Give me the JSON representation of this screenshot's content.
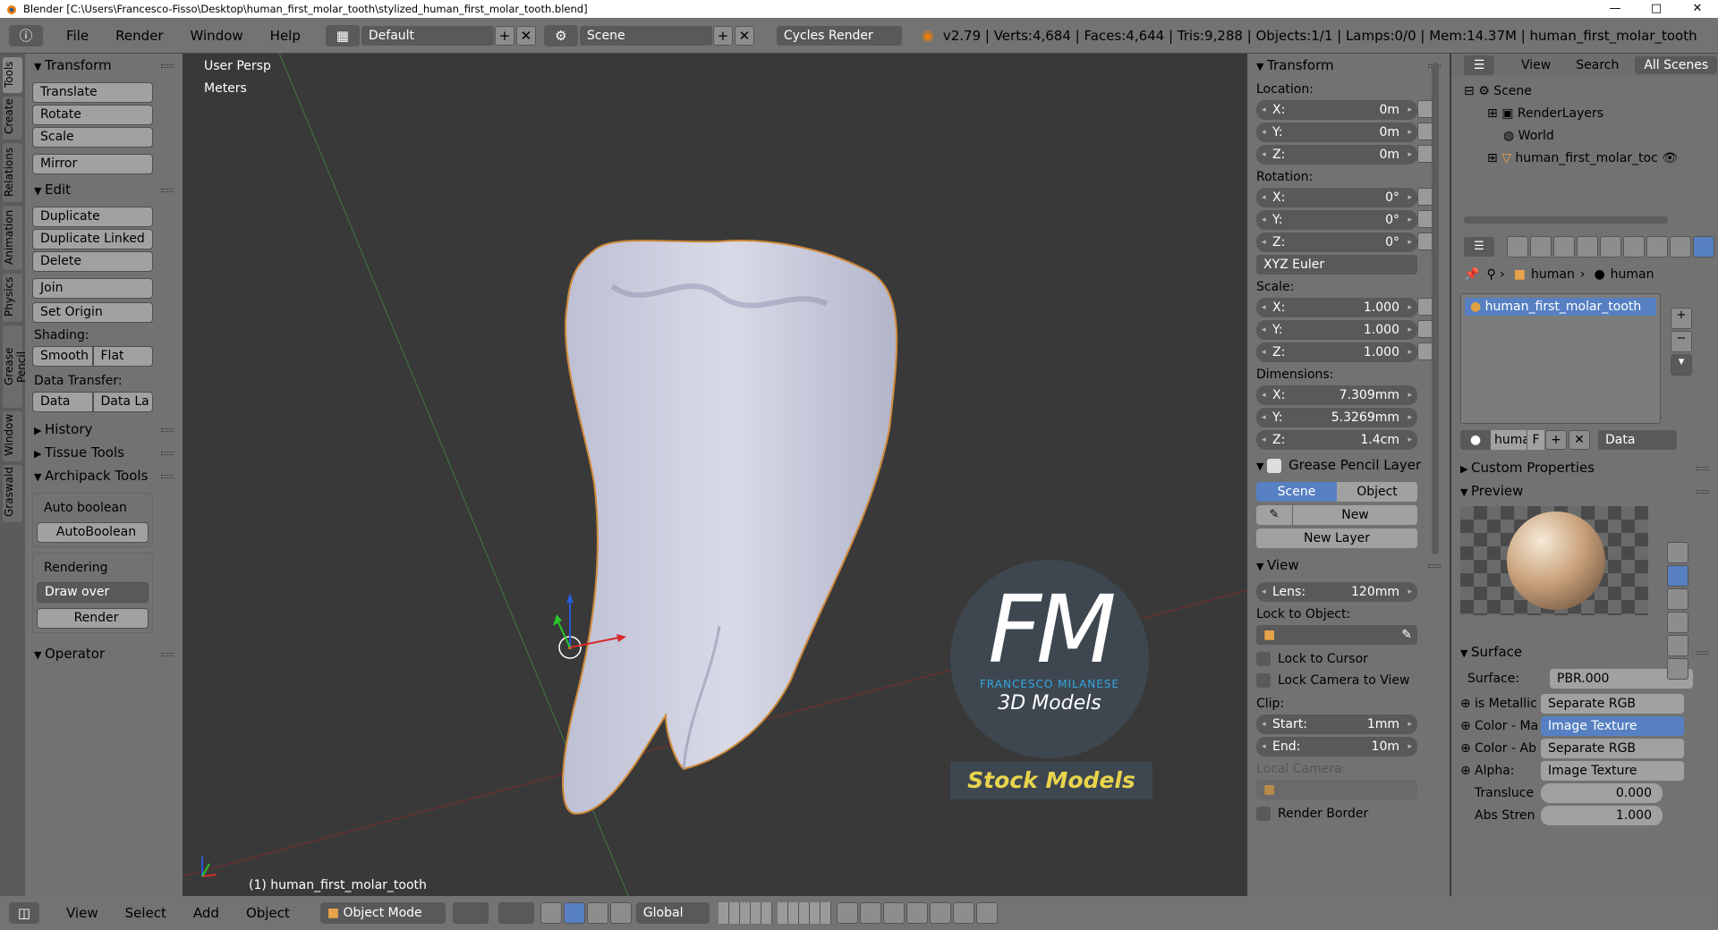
{
  "title": "Blender [C:\\Users\\Francesco-Fisso\\Desktop\\human_first_molar_tooth\\stylized_human_first_molar_tooth.blend]",
  "window_controls": [
    "—",
    "□",
    "✕"
  ],
  "menu": {
    "items": [
      "File",
      "Render",
      "Window",
      "Help"
    ]
  },
  "header": {
    "layout": "Default",
    "scene": "Scene",
    "engine": "Cycles Render",
    "stats": "v2.79 | Verts:4,684 | Faces:4,644 | Tris:9,288 | Objects:1/1 | Lamps:0/0 | Mem:14.37M | human_first_molar_tooth"
  },
  "tool_tabs": [
    "Tools",
    "Create",
    "Relations",
    "Animation",
    "Physics",
    "Grease Pencil",
    "Window",
    "Graswald"
  ],
  "tools": {
    "transform_header": "Transform",
    "translate": "Translate",
    "rotate": "Rotate",
    "scale": "Scale",
    "mirror": "Mirror",
    "edit_header": "Edit",
    "duplicate": "Duplicate",
    "duplicate_linked": "Duplicate Linked",
    "delete": "Delete",
    "join": "Join",
    "set_origin": "Set Origin",
    "shading_label": "Shading:",
    "smooth": "Smooth",
    "flat": "Flat",
    "data_transfer_label": "Data Transfer:",
    "data": "Data",
    "data_la": "Data La",
    "history": "History",
    "tissue_tools": "Tissue Tools",
    "archipack_tools": "Archipack Tools",
    "auto_boolean_label": "Auto boolean",
    "auto_boolean_btn": "AutoBoolean",
    "rendering_label": "Rendering",
    "draw_over": "Draw over",
    "render": "Render",
    "operator": "Operator"
  },
  "viewport": {
    "view_name": "User Persp",
    "units": "Meters",
    "object_label": "(1) human_first_molar_tooth",
    "watermark_initials": "FM",
    "watermark_name": "FRANCESCO MILANESE",
    "watermark_sub": "3D Models",
    "watermark_banner": "Stock Models"
  },
  "properties_n": {
    "transform_header": "Transform",
    "location_label": "Location:",
    "location": [
      {
        "axis": "X:",
        "value": "0m"
      },
      {
        "axis": "Y:",
        "value": "0m"
      },
      {
        "axis": "Z:",
        "value": "0m"
      }
    ],
    "rotation_label": "Rotation:",
    "rotation": [
      {
        "axis": "X:",
        "value": "0°"
      },
      {
        "axis": "Y:",
        "value": "0°"
      },
      {
        "axis": "Z:",
        "value": "0°"
      }
    ],
    "rotation_mode": "XYZ Euler",
    "scale_label": "Scale:",
    "scale": [
      {
        "axis": "X:",
        "value": "1.000"
      },
      {
        "axis": "Y:",
        "value": "1.000"
      },
      {
        "axis": "Z:",
        "value": "1.000"
      }
    ],
    "dimensions_label": "Dimensions:",
    "dimensions": [
      {
        "axis": "X:",
        "value": "7.309mm"
      },
      {
        "axis": "Y:",
        "value": "5.3269mm"
      },
      {
        "axis": "Z:",
        "value": "1.4cm"
      }
    ],
    "grease_header": "Grease Pencil Layer",
    "scene_tab": "Scene",
    "object_tab": "Object",
    "new": "New",
    "new_layer": "New Layer",
    "view_header": "View",
    "lens_label": "Lens:",
    "lens_value": "120mm",
    "lock_object_label": "Lock to Object:",
    "lock_cursor": "Lock to Cursor",
    "lock_camera": "Lock Camera to View",
    "clip_label": "Clip:",
    "clip_start_label": "Start:",
    "clip_start_value": "1mm",
    "clip_end_label": "End:",
    "clip_end_value": "10m",
    "local_camera_label": "Local Camera:",
    "render_border": "Render Border"
  },
  "outliner": {
    "view": "View",
    "search": "Search",
    "filter": "All Scenes",
    "items": [
      "Scene",
      "RenderLayers",
      "World",
      "human_first_molar_toc"
    ]
  },
  "props": {
    "breadcrumb1": "human",
    "breadcrumb2": "human",
    "material_slot": "human_first_molar_tooth",
    "mat_name": "huma",
    "mat_f": "F",
    "data_dropdown": "Data",
    "custom_props": "Custom Properties",
    "preview": "Preview",
    "surface_header": "Surface",
    "surface_label": "Surface:",
    "surface_value": "PBR.000",
    "rows": [
      {
        "label": "is Metallic",
        "value": "Separate RGB"
      },
      {
        "label": "Color - Ma",
        "value": "Image Texture"
      },
      {
        "label": "Color - Ab",
        "value": "Separate RGB"
      },
      {
        "label": "Alpha:",
        "value": "Image Texture"
      }
    ],
    "translucency_label": "Transluce",
    "translucency_value": "0.000",
    "abs_label": "Abs Stren",
    "abs_value": "1.000"
  },
  "bottom": {
    "menu": [
      "View",
      "Select",
      "Add",
      "Object"
    ],
    "mode": "Object Mode",
    "orientation": "Global"
  }
}
